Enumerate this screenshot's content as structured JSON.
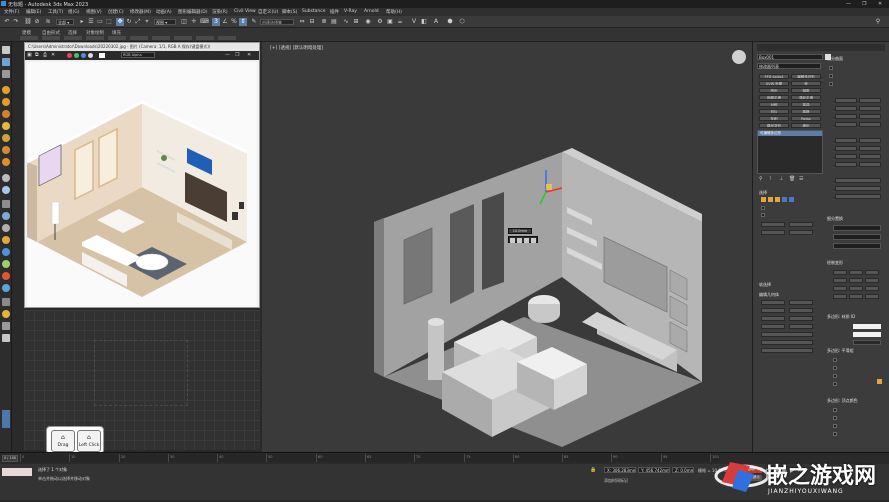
{
  "window": {
    "title": "无标题 - Autodesk 3ds Max 2023",
    "controls": [
      "—",
      "❐",
      "✕"
    ]
  },
  "menu": [
    "文件(F)",
    "编辑(E)",
    "工具(T)",
    "组(G)",
    "视图(V)",
    "创建(C)",
    "修改器(M)",
    "动画(A)",
    "图形编辑器(D)",
    "渲染(R)",
    "Civil View",
    "自定义(U)",
    "脚本(S)",
    "Substance",
    "插件",
    "V-Ray",
    "Arnold",
    "帮助(H)"
  ],
  "toolbar": {
    "view_dropdown": "视图",
    "selection_set": "创建选择集"
  },
  "tabs": [
    "建模",
    "自由形式",
    "选择",
    "对象绘制",
    "填充"
  ],
  "scene_file": {
    "title": "C:\\Users\\Administrator\\Downloads\\20220302.jpg - 图片 (Camera: 1/1, RGB A 保存(键盘模式))",
    "zoom": "RGB Alpha"
  },
  "viewport": {
    "label": "[+] [透视] [默认明暗处理]",
    "popup_label": "10.0mm"
  },
  "keyboard_hint": {
    "drag": "Drag",
    "left_click": "Left Click"
  },
  "cmd_panel": {
    "object_name": "Box001",
    "modifier_list": "修改器列表",
    "buttons": [
      "FFD 4x4x4",
      "编辑多边形",
      "UVW 贴图",
      "壳",
      "挤出",
      "倒角",
      "网格平滑",
      "涡轮平滑",
      "对称",
      "弯曲",
      "切片",
      "晶格",
      "车削",
      "Relax",
      "路径变形",
      "细化"
    ],
    "stack_item": "可编辑多边形",
    "rollouts": [
      "选择",
      "软选择",
      "编辑几何体",
      "细分曲面",
      "细分置换",
      "绘制变形",
      "多边形: 材质 ID",
      "多边形: 平滑组",
      "多边形: 顶点颜色"
    ],
    "right_labels": [
      "保持子对象选择",
      "约束",
      "无",
      "边",
      "面",
      "法线",
      "保持 UV",
      "重复上一个",
      "创建",
      "塌陷",
      "附加",
      "分离",
      "切片平面",
      "分割",
      "快速切片",
      "切割",
      "网格平滑",
      "细化",
      "平面化",
      "视图对齐",
      "栅格对齐",
      "松弛",
      "隐藏选定对象",
      "全部取消隐藏"
    ]
  },
  "timeline": {
    "frame": "0 / 100",
    "ticks": [
      "0",
      "10",
      "20",
      "30",
      "40",
      "50",
      "60",
      "65",
      "70",
      "75",
      "80",
      "85",
      "90",
      "95",
      "100"
    ]
  },
  "status": {
    "selection": "选择了 1 个对象",
    "prompt": "单击并拖动以选择并移动对象",
    "x": "X: 306.283mm",
    "y": "Y: 456.742mm",
    "z": "Z: 0.0mm",
    "grid": "栅格 = 10.0mm",
    "add_key": "添加时间标记",
    "autokey": "自动",
    "setkey": "设置关键点"
  },
  "watermark": {
    "brand": "嵌之游戏网",
    "url": "JIANZHIYOUXIWANG"
  },
  "colors": {
    "accent": "#5a7ea8",
    "panel": "#3c3c3c",
    "viewport": "#3a3a3a",
    "timeline_red": "#c0392b"
  }
}
